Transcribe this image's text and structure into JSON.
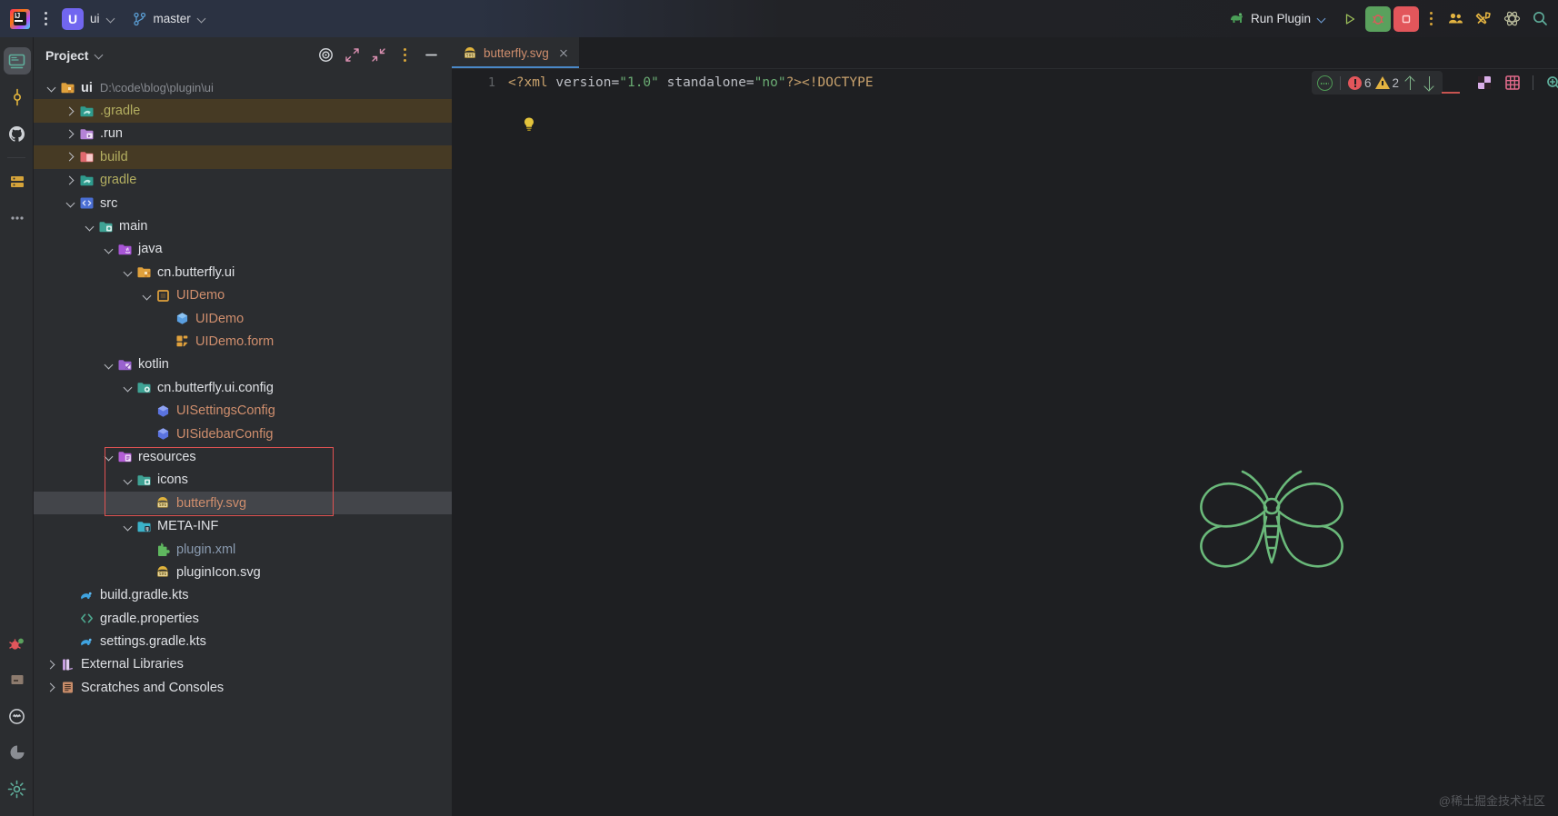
{
  "titlebar": {
    "project_badge": "U",
    "project_name": "ui",
    "branch_name": "master",
    "run_config": "Run Plugin",
    "logo_text": "IJ",
    "icons": {
      "main_menu": "kebab-menu-icon",
      "run": "run-icon",
      "debug": "debug-icon",
      "stop": "stop-icon",
      "more": "more-vertical-icon",
      "collaborate": "collaborate-icon",
      "tools": "tools-icon",
      "ai_assistant": "ai-assistant-icon",
      "search": "search-icon"
    }
  },
  "activity_bar": {
    "top_items": [
      {
        "name": "project",
        "icon": "project-monitor-icon",
        "selected": true
      },
      {
        "name": "commit",
        "icon": "commit-icon",
        "selected": false
      },
      {
        "name": "github",
        "icon": "github-icon",
        "selected": false
      },
      {
        "name": "database",
        "icon": "database-icon",
        "selected": false
      },
      {
        "name": "more-tool-windows",
        "icon": "more-horizontal-icon",
        "selected": false
      }
    ],
    "bottom_items": [
      {
        "name": "debug",
        "icon": "bug-icon",
        "selected": false
      },
      {
        "name": "build",
        "icon": "build-box-icon",
        "selected": false
      },
      {
        "name": "terminal",
        "icon": "terminal-face-icon",
        "selected": false
      },
      {
        "name": "profiler",
        "icon": "profiler-pie-icon",
        "selected": false
      },
      {
        "name": "settings",
        "icon": "gear-icon",
        "selected": false
      }
    ]
  },
  "project_panel": {
    "title": "Project",
    "header_actions": [
      {
        "name": "select-opened-file",
        "icon": "target-icon"
      },
      {
        "name": "expand-all",
        "icon": "expand-all-icon"
      },
      {
        "name": "collapse-all",
        "icon": "collapse-all-icon"
      },
      {
        "name": "options",
        "icon": "more-vertical-icon"
      },
      {
        "name": "hide",
        "icon": "minimize-icon"
      }
    ],
    "tree": [
      {
        "label": "ui",
        "sub": "D:\\code\\blog\\plugin\\ui",
        "indent": 0,
        "arrow": "down",
        "icon": "module-folder-icon",
        "color": "#dfe1e5",
        "bold": true
      },
      {
        "label": ".gradle",
        "indent": 1,
        "arrow": "right",
        "icon": "gradle-folder-icon",
        "color": "#b3ae60",
        "highlight": "brown"
      },
      {
        "label": ".run",
        "indent": 1,
        "arrow": "right",
        "icon": "run-folder-icon",
        "color": "#dfe1e5"
      },
      {
        "label": "build",
        "indent": 1,
        "arrow": "right",
        "icon": "build-folder-icon",
        "color": "#b3ae60",
        "highlight": "brown"
      },
      {
        "label": "gradle",
        "indent": 1,
        "arrow": "right",
        "icon": "gradle-folder-icon",
        "color": "#b3ae60"
      },
      {
        "label": "src",
        "indent": 1,
        "arrow": "down",
        "icon": "source-root-icon",
        "color": "#dfe1e5"
      },
      {
        "label": "main",
        "indent": 2,
        "arrow": "down",
        "icon": "folder-icon",
        "color": "#dfe1e5"
      },
      {
        "label": "java",
        "indent": 3,
        "arrow": "down",
        "icon": "java-source-folder-icon",
        "color": "#dfe1e5"
      },
      {
        "label": "cn.butterfly.ui",
        "indent": 4,
        "arrow": "down",
        "icon": "package-icon",
        "color": "#dfe1e5"
      },
      {
        "label": "UIDemo",
        "indent": 5,
        "arrow": "down",
        "icon": "form-class-icon",
        "color": "#cf8e6d"
      },
      {
        "label": "UIDemo",
        "indent": 6,
        "arrow": "none",
        "icon": "java-class-icon",
        "color": "#cf8e6d"
      },
      {
        "label": "UIDemo.form",
        "indent": 6,
        "arrow": "none",
        "icon": "gui-form-icon",
        "color": "#cf8e6d"
      },
      {
        "label": "kotlin",
        "indent": 3,
        "arrow": "down",
        "icon": "kotlin-source-folder-icon",
        "color": "#dfe1e5"
      },
      {
        "label": "cn.butterfly.ui.config",
        "indent": 4,
        "arrow": "down",
        "icon": "package-config-icon",
        "color": "#dfe1e5"
      },
      {
        "label": "UISettingsConfig",
        "indent": 5,
        "arrow": "none",
        "icon": "kotlin-class-icon",
        "color": "#cf8e6d"
      },
      {
        "label": "UISidebarConfig",
        "indent": 5,
        "arrow": "none",
        "icon": "kotlin-class-icon",
        "color": "#cf8e6d"
      },
      {
        "label": "resources",
        "indent": 3,
        "arrow": "down",
        "icon": "resources-folder-icon",
        "color": "#dfe1e5"
      },
      {
        "label": "icons",
        "indent": 4,
        "arrow": "down",
        "icon": "folder-icon",
        "color": "#dfe1e5"
      },
      {
        "label": "butterfly.svg",
        "indent": 5,
        "arrow": "none",
        "icon": "svg-file-icon",
        "color": "#cf8e6d",
        "selected": true
      },
      {
        "label": "META-INF",
        "indent": 4,
        "arrow": "down",
        "icon": "meta-inf-folder-icon",
        "color": "#dfe1e5"
      },
      {
        "label": "plugin.xml",
        "indent": 5,
        "arrow": "none",
        "icon": "plugin-xml-icon",
        "color": "#8a9bb0"
      },
      {
        "label": "pluginIcon.svg",
        "indent": 5,
        "arrow": "none",
        "icon": "svg-file-icon",
        "color": "#dfe1e5"
      },
      {
        "label": "build.gradle.kts",
        "indent": 1,
        "arrow": "none",
        "icon": "gradle-file-icon",
        "color": "#dfe1e5"
      },
      {
        "label": "gradle.properties",
        "indent": 1,
        "arrow": "none",
        "icon": "properties-file-icon",
        "color": "#dfe1e5"
      },
      {
        "label": "settings.gradle.kts",
        "indent": 1,
        "arrow": "none",
        "icon": "gradle-file-icon",
        "color": "#dfe1e5"
      },
      {
        "label": "External Libraries",
        "indent": 0,
        "arrow": "right",
        "icon": "libraries-icon",
        "color": "#dfe1e5"
      },
      {
        "label": "Scratches and Consoles",
        "indent": 0,
        "arrow": "right",
        "icon": "scratches-icon",
        "color": "#dfe1e5"
      }
    ]
  },
  "editor": {
    "tab": {
      "name": "butterfly.svg",
      "icon": "svg-file-icon"
    },
    "line_number": "1",
    "code": {
      "t1": "<?xml",
      "t2": " version=",
      "t3": "\"1.0\"",
      "t4": " standalone=",
      "t5": "\"no\"",
      "t6": "?><!DOCTYPE"
    },
    "inspection_widget": {
      "icon": "inspection-ring-icon",
      "error_count": "6",
      "warning_count": "2",
      "prev_label": "prev-problem-arrow",
      "next_label": "next-problem-arrow"
    },
    "svg_toolbar": [
      {
        "name": "toggle-transparency-chessboard",
        "icon": "checkerboard-icon"
      },
      {
        "name": "toggle-grid",
        "icon": "grid-icon"
      },
      {
        "name": "zoom-in",
        "icon": "zoom-in-icon"
      },
      {
        "name": "zoom-out",
        "icon": "zoom-out-icon"
      },
      {
        "name": "actual-size",
        "icon": "zoom-actual-icon"
      },
      {
        "name": "fit-to-window",
        "icon": "fit-window-icon"
      },
      {
        "name": "color-picker",
        "icon": "eyedropper-icon"
      },
      {
        "name": "show-source",
        "icon": "code-view-icon"
      }
    ],
    "intention_bulb": "lightbulb-icon",
    "preview_image": "butterfly-svg-preview",
    "preview_color": "#6ab97a"
  },
  "watermark": "@稀土掘金技术社区"
}
